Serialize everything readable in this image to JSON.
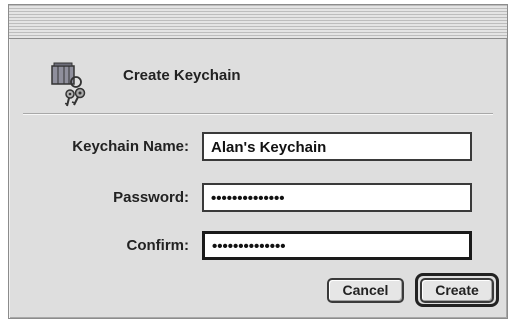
{
  "dialog": {
    "title": "Create Keychain",
    "icon": "keychain-icon"
  },
  "fields": {
    "name": {
      "label": "Keychain Name:",
      "value": "Alan's Keychain"
    },
    "password": {
      "label": "Password:",
      "value": "••••••••••••••"
    },
    "confirm": {
      "label": "Confirm:",
      "value": "••••••••••••••"
    }
  },
  "buttons": {
    "cancel": "Cancel",
    "create": "Create"
  }
}
